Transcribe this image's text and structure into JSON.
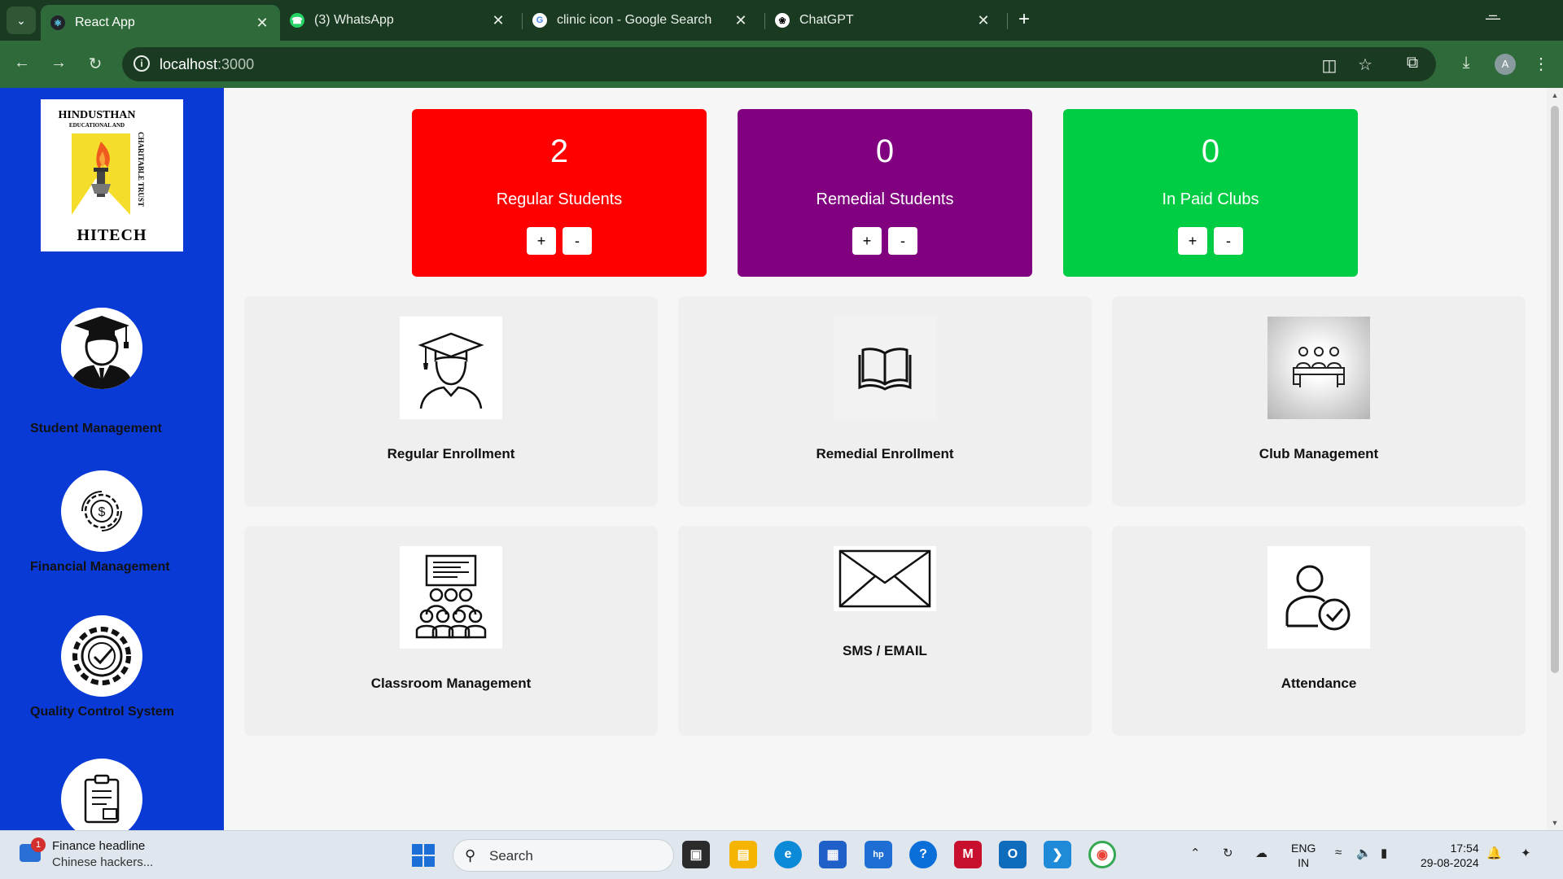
{
  "browser": {
    "tabs": [
      {
        "title": "React App",
        "active": true
      },
      {
        "title": "(3) WhatsApp",
        "active": false
      },
      {
        "title": "clinic icon - Google Search",
        "active": false
      },
      {
        "title": "ChatGPT",
        "active": false
      }
    ],
    "url_host": "localhost",
    "url_port": ":3000",
    "profile_initial": "A"
  },
  "sidebar": {
    "logo": {
      "top_text": "HINDUSTHAN",
      "sub_text": "EDUCATIONAL AND",
      "side_text": "CHARITABLE TRUST",
      "bottom_text": "HITECH"
    },
    "items": [
      {
        "label": "Student Management",
        "icon": "graduate-icon"
      },
      {
        "label": "Financial Management",
        "icon": "money-gear-icon"
      },
      {
        "label": "Quality Control System",
        "icon": "quality-gear-icon"
      },
      {
        "label": "",
        "icon": "clipboard-checklist-icon"
      }
    ]
  },
  "stats": [
    {
      "value": "2",
      "label": "Regular Students",
      "color": "#ff0000",
      "plus": "+",
      "minus": "-"
    },
    {
      "value": "0",
      "label": "Remedial Students",
      "color": "#800080",
      "plus": "+",
      "minus": "-"
    },
    {
      "value": "0",
      "label": "In Paid Clubs",
      "color": "#00cc44",
      "plus": "+",
      "minus": "-"
    }
  ],
  "cards": [
    {
      "label": "Regular Enrollment",
      "icon": "graduate-outline-icon"
    },
    {
      "label": "Remedial Enrollment",
      "icon": "open-book-icon"
    },
    {
      "label": "Club Management",
      "icon": "meeting-table-icon"
    },
    {
      "label": "Classroom Management",
      "icon": "classroom-icon"
    },
    {
      "label": "SMS / EMAIL",
      "icon": "envelope-icon"
    },
    {
      "label": "Attendance",
      "icon": "user-check-icon"
    }
  ],
  "taskbar": {
    "news_title": "Finance headline",
    "news_sub": "Chinese hackers...",
    "news_badge": "1",
    "search_label": "Search",
    "lang_top": "ENG",
    "lang_bottom": "IN",
    "time": "17:54",
    "date": "29-08-2024"
  }
}
